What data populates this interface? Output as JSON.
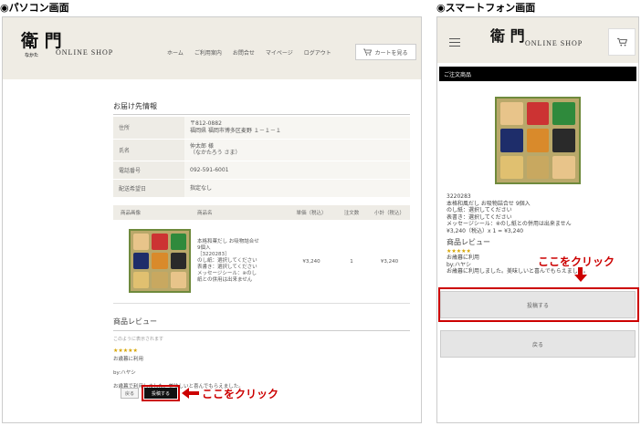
{
  "labels": {
    "pc": "◉パソコン画面",
    "sp": "◉スマートフォン画面"
  },
  "pc": {
    "logo": "衛 門",
    "logo_sub": "なかた",
    "shop_name": "ONLINE SHOP",
    "nav": [
      "ホーム",
      "ご利用案内",
      "お問合せ",
      "マイページ",
      "ログアウト"
    ],
    "cart_label": "カートを見る",
    "section_title": "お届け先情報",
    "info_rows": [
      {
        "key": "住所",
        "value1": "〒812-0882",
        "value2": "福岡県 福岡市博多区麦野 １－１－１"
      },
      {
        "key": "氏名",
        "value1": "仲太郎 様",
        "value2": "（なかたろう さま）"
      },
      {
        "key": "電話番号",
        "value1": "092-591-6001",
        "value2": ""
      },
      {
        "key": "配送希望日",
        "value1": "指定なし",
        "value2": ""
      }
    ],
    "items_headers": [
      "商品画像",
      "商品名",
      "単価（税込）",
      "注文数",
      "小計（税込）"
    ],
    "item": {
      "name_lines": [
        "本格和菓だし お吸物詰合せ",
        "9個入",
        "［3220283］",
        "のし紙：選択してください",
        "表書き：選択してください",
        "メッセージシール：※のし",
        "紙との併用は出来ません"
      ],
      "price": "¥3,240",
      "qty": "1",
      "subtotal": "¥3,240"
    },
    "review_title": "商品レビュー",
    "review_note": "このように表示されます",
    "stars": "★★★★★",
    "review_heading": "お歳暮に利用",
    "review_by": "by:ハヤシ",
    "review_body": "お歳暮で利用しました。美味しいと喜んでもらえました。",
    "back_label": "戻る",
    "post_label": "投稿する",
    "click_label": "ここをクリック"
  },
  "sp": {
    "logo": "衛 門",
    "shop_name": "ONLINE SHOP",
    "order_bar": "ご注文商品",
    "text_lines": [
      "3220283",
      "本格和風だし お吸物詰合せ 9個入",
      "のし紙：選択してください",
      "表書き：選択してください",
      "メッセージシール：※のし紙との併用は出来ません",
      "¥3,240（税込）x 1 = ¥3,240"
    ],
    "review_title": "商品レビュー",
    "stars": "★★★★★",
    "review_heading": "お歳暮に利用",
    "review_by": "by:ハヤシ",
    "review_body": "お歳暮に利用しました。美味しいと喜んでもらえました。",
    "click_label": "ここをクリック",
    "post_label": "投稿する",
    "back_label": "戻る"
  },
  "colors": {
    "accent": "#cc0000",
    "header_bg": "#efece4",
    "box_green": "#6f8a3c"
  },
  "icons": [
    "cart-icon",
    "menu-icon",
    "arrow-left-icon",
    "arrow-down-icon"
  ]
}
